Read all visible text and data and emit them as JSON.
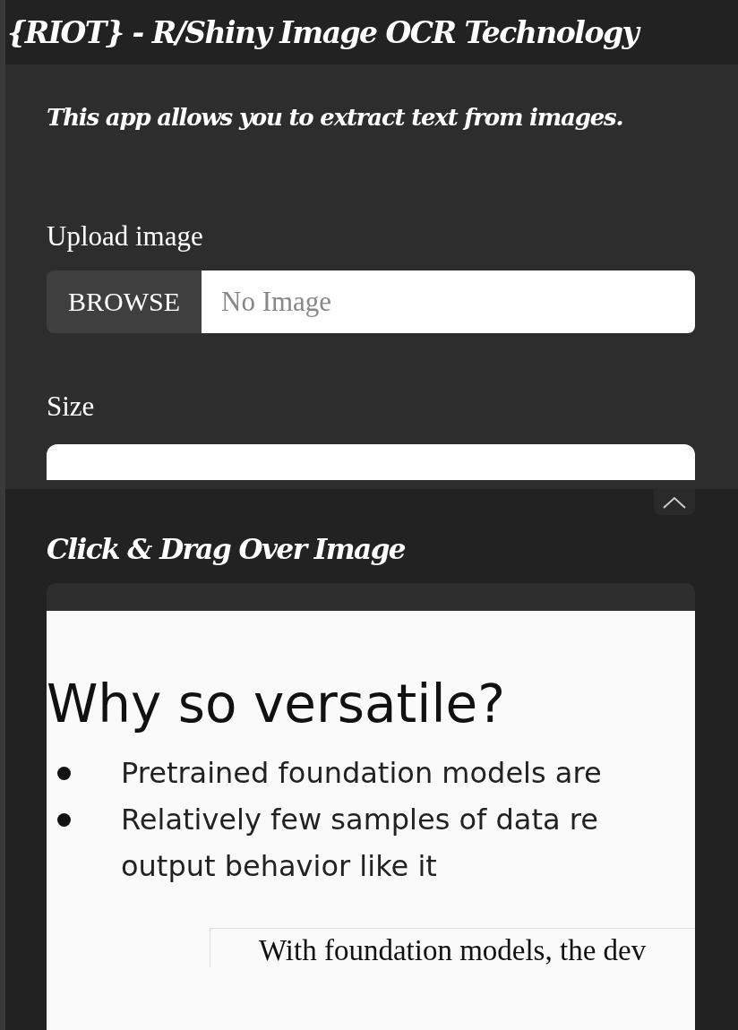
{
  "header": {
    "title": "{RIOT} - R/Shiny Image OCR Technology"
  },
  "intro": "This app allows you to extract text from images.",
  "upload": {
    "label": "Upload image",
    "button": "BROWSE",
    "placeholder": "No Image"
  },
  "size": {
    "label": "Size"
  },
  "panel": {
    "expanded": true,
    "heading": "Click & Drag Over Image",
    "image": {
      "title": "Why so versatile?",
      "lines": [
        {
          "kind": "bullet",
          "text": "Pretrained foundation models are"
        },
        {
          "kind": "bullet",
          "text": "Relatively few samples of data re"
        },
        {
          "kind": "continuation",
          "text": "output behavior like it"
        }
      ],
      "quote": "With foundation models, the dev"
    }
  }
}
